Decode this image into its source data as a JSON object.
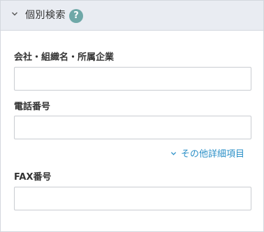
{
  "panel": {
    "title": "個別検索",
    "help_glyph": "?",
    "icons": {
      "collapse": "chevron-down-icon",
      "help": "question-circle-icon"
    },
    "colors": {
      "header_bg": "#e9ecf2",
      "help_badge": "#6fa8a8",
      "link": "#2a8fc7"
    }
  },
  "fields": {
    "company": {
      "label": "会社・組織名・所属企業",
      "value": ""
    },
    "phone": {
      "label": "電話番号",
      "value": ""
    },
    "fax": {
      "label": "FAX番号",
      "value": ""
    }
  },
  "more_link": {
    "label": "その他詳細項目"
  }
}
